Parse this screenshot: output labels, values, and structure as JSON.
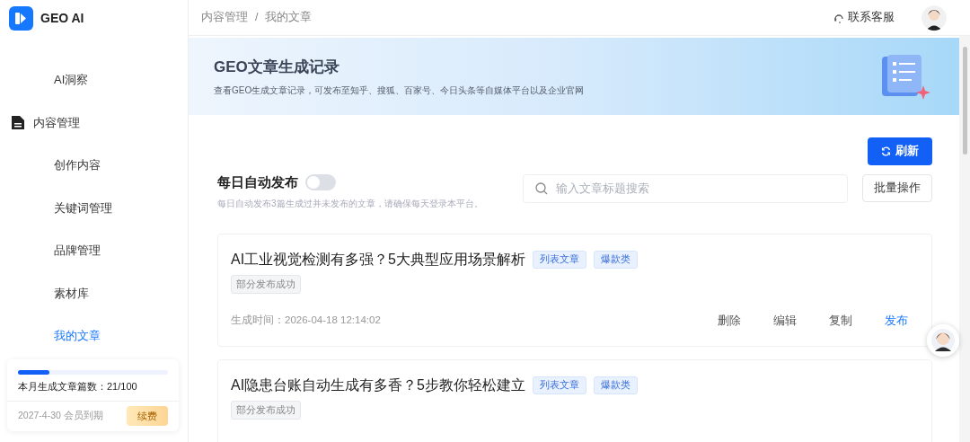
{
  "app": {
    "name": "GEO AI"
  },
  "sidebar": {
    "items": [
      {
        "label": "AI洞察",
        "kind": "sub",
        "selected": false
      },
      {
        "label": "内容管理",
        "kind": "group",
        "selected": false
      },
      {
        "label": "创作内容",
        "kind": "sub",
        "selected": false
      },
      {
        "label": "关键词管理",
        "kind": "sub",
        "selected": false
      },
      {
        "label": "品牌管理",
        "kind": "sub",
        "selected": false
      },
      {
        "label": "素材库",
        "kind": "sub",
        "selected": false
      },
      {
        "label": "我的文章",
        "kind": "sub",
        "selected": true
      }
    ],
    "usage": {
      "level": 0.21,
      "text": "本月生成文章篇数：21/100",
      "expiry": "2027-4-30 会员到期",
      "renew": "续费"
    }
  },
  "breadcrumb": {
    "items": [
      "内容管理",
      "我的文章"
    ],
    "separator": "/"
  },
  "header": {
    "support": "联系客服"
  },
  "banner": {
    "title": "GEO文章生成记录",
    "subtitle": "查看GEO生成文章记录，可发布至知乎、搜狐、百家号、今日头条等自媒体平台以及企业官网"
  },
  "refresh_button": "刷新",
  "auto_publish": {
    "label": "每日自动发布",
    "on": false,
    "hint": "每日自动发布3篇生成过并未发布的文章，请确保每天登录本平台。"
  },
  "search": {
    "placeholder": "输入文章标题搜索"
  },
  "batch_button": "批量操作",
  "articles": [
    {
      "title": "AI工业视觉检测有多强？5大典型应用场景解析",
      "tags": [
        "列表文章",
        "爆款类"
      ],
      "status": "部分发布成功",
      "time": "生成时间：2026-04-18 12:14:02",
      "actions": [
        {
          "label": "删除",
          "kind": "normal"
        },
        {
          "label": "编辑",
          "kind": "normal"
        },
        {
          "label": "复制",
          "kind": "normal"
        },
        {
          "label": "发布",
          "kind": "primary"
        }
      ]
    },
    {
      "title": "AI隐患台账自动生成有多香？5步教你轻松建立",
      "tags": [
        "列表文章",
        "爆款类"
      ],
      "status": "部分发布成功"
    }
  ]
}
